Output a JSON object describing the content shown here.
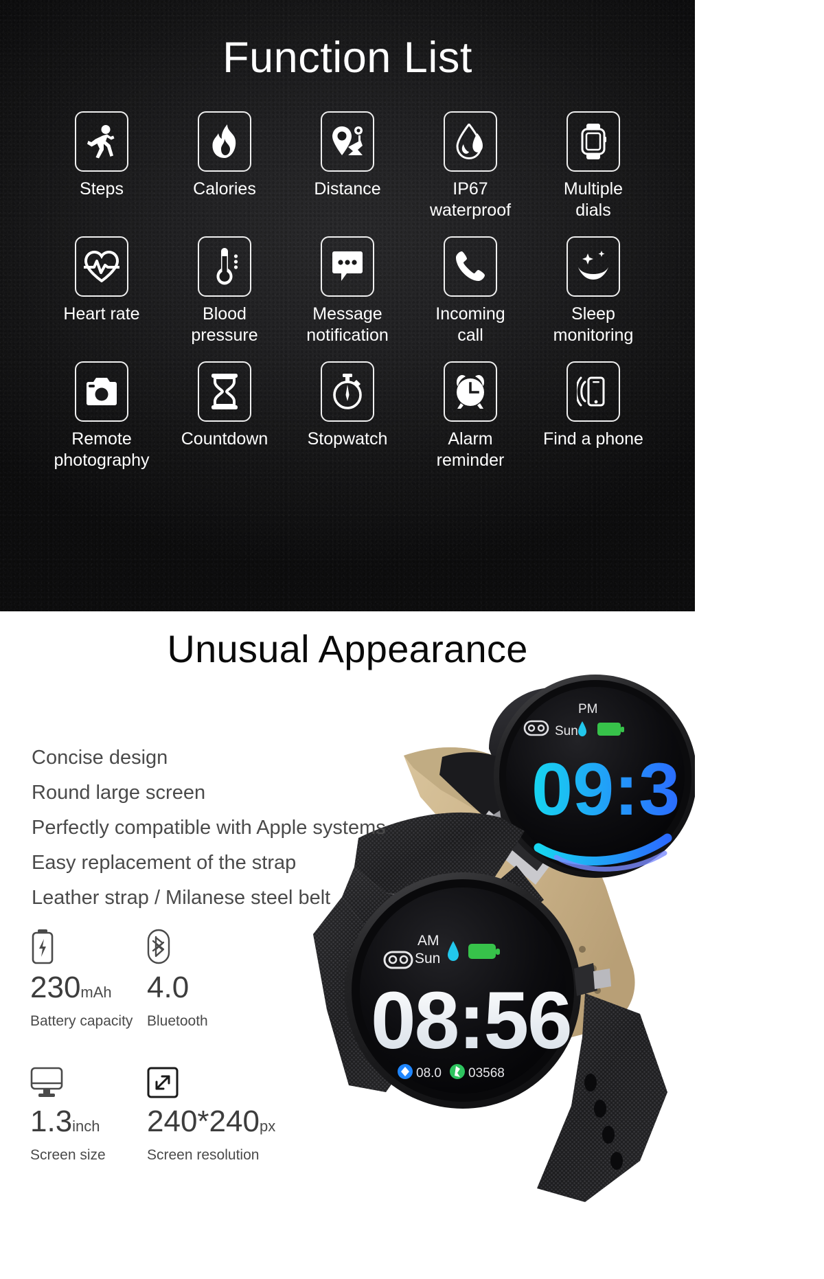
{
  "function_section": {
    "title": "Function List",
    "features": [
      [
        {
          "label": "Steps",
          "icon": "running-icon"
        },
        {
          "label": "Calories",
          "icon": "flame-icon"
        },
        {
          "label": "Distance",
          "icon": "map-pin-icon"
        },
        {
          "label": "IP67\nwaterproof",
          "icon": "water-drop-icon"
        },
        {
          "label": "Multiple\ndials",
          "icon": "smartwatch-icon"
        }
      ],
      [
        {
          "label": "Heart rate",
          "icon": "heart-pulse-icon"
        },
        {
          "label": "Blood pressure",
          "icon": "thermometer-icon"
        },
        {
          "label": "Message\nnotification",
          "icon": "chat-bubble-icon"
        },
        {
          "label": "Incoming\ncall",
          "icon": "phone-icon"
        },
        {
          "label": "Sleep\nmonitoring",
          "icon": "moon-star-icon"
        }
      ],
      [
        {
          "label": "Remote\nphotography",
          "icon": "camera-icon"
        },
        {
          "label": "Countdown",
          "icon": "hourglass-icon"
        },
        {
          "label": "Stopwatch",
          "icon": "stopwatch-icon"
        },
        {
          "label": "Alarm\nreminder",
          "icon": "alarm-clock-icon"
        },
        {
          "label": "Find a phone",
          "icon": "find-phone-icon"
        }
      ]
    ]
  },
  "appearance_section": {
    "title": "Unusual Appearance",
    "bullets": [
      "Concise design",
      "Round large screen",
      "Perfectly compatible with Apple systems",
      "Easy replacement of the strap",
      "Leather strap / Milanese steel belt"
    ],
    "specs": [
      [
        {
          "icon": "battery-charging-icon",
          "value": "230",
          "unit": "mAh",
          "label": "Battery capacity"
        },
        {
          "icon": "bluetooth-icon",
          "value": "4.0",
          "unit": "",
          "label": "Bluetooth"
        }
      ],
      [
        {
          "icon": "monitor-icon",
          "value": "1.3",
          "unit": "inch",
          "label": "Screen size"
        },
        {
          "icon": "resize-arrows-icon",
          "value": "240*240",
          "unit": "px",
          "label": "Screen resolution"
        }
      ]
    ],
    "product_photo": {
      "front_watch": {
        "time": "08:56",
        "meridiem": "AM",
        "day": "Sun",
        "steps": "03568",
        "battery_level": "08.0"
      },
      "back_watch": {
        "time": "09:3",
        "meridiem": "PM",
        "day": "Sun"
      }
    }
  },
  "colors": {
    "dark_bg": "#141415",
    "white_bg": "#ffffff",
    "icon_stroke": "#f0f0f0",
    "body_text": "#4a4a4a",
    "heading": "#0a0a0a",
    "watch_accent_cyan": "#19c8e8",
    "watch_accent_blue": "#1f5cff",
    "battery_green": "#37c24a"
  }
}
